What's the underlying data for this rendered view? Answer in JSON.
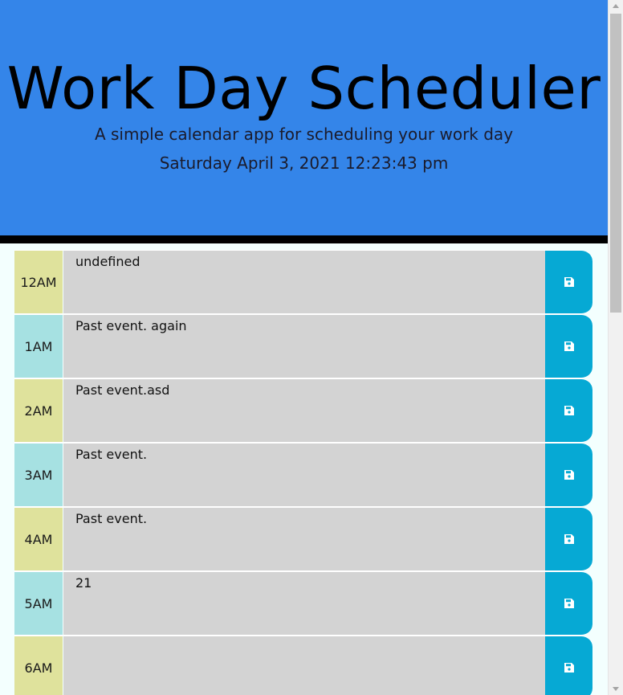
{
  "header": {
    "title": "Work Day Scheduler",
    "lead": "A simple calendar app for scheduling your work day",
    "current_date": "Saturday April 3, 2021 12:23:43 pm"
  },
  "colors": {
    "header_bg": "#3485e9",
    "past_hour_yellow": "#dfe29c",
    "past_hour_cyan": "#a6e1e2",
    "entry_bg": "#d3d3d3",
    "save_button": "#06a9d4"
  },
  "schedule": {
    "rows": [
      {
        "hour": "12AM",
        "text": "undefined",
        "save_icon": "save-icon"
      },
      {
        "hour": "1AM",
        "text": "Past event. again",
        "save_icon": "save-icon"
      },
      {
        "hour": "2AM",
        "text": "Past event.asd",
        "save_icon": "save-icon"
      },
      {
        "hour": "3AM",
        "text": "Past event.",
        "save_icon": "save-icon"
      },
      {
        "hour": "4AM",
        "text": "Past event.",
        "save_icon": "save-icon"
      },
      {
        "hour": "5AM",
        "text": "21",
        "save_icon": "save-icon"
      },
      {
        "hour": "6AM",
        "text": "",
        "save_icon": "save-icon"
      }
    ]
  }
}
